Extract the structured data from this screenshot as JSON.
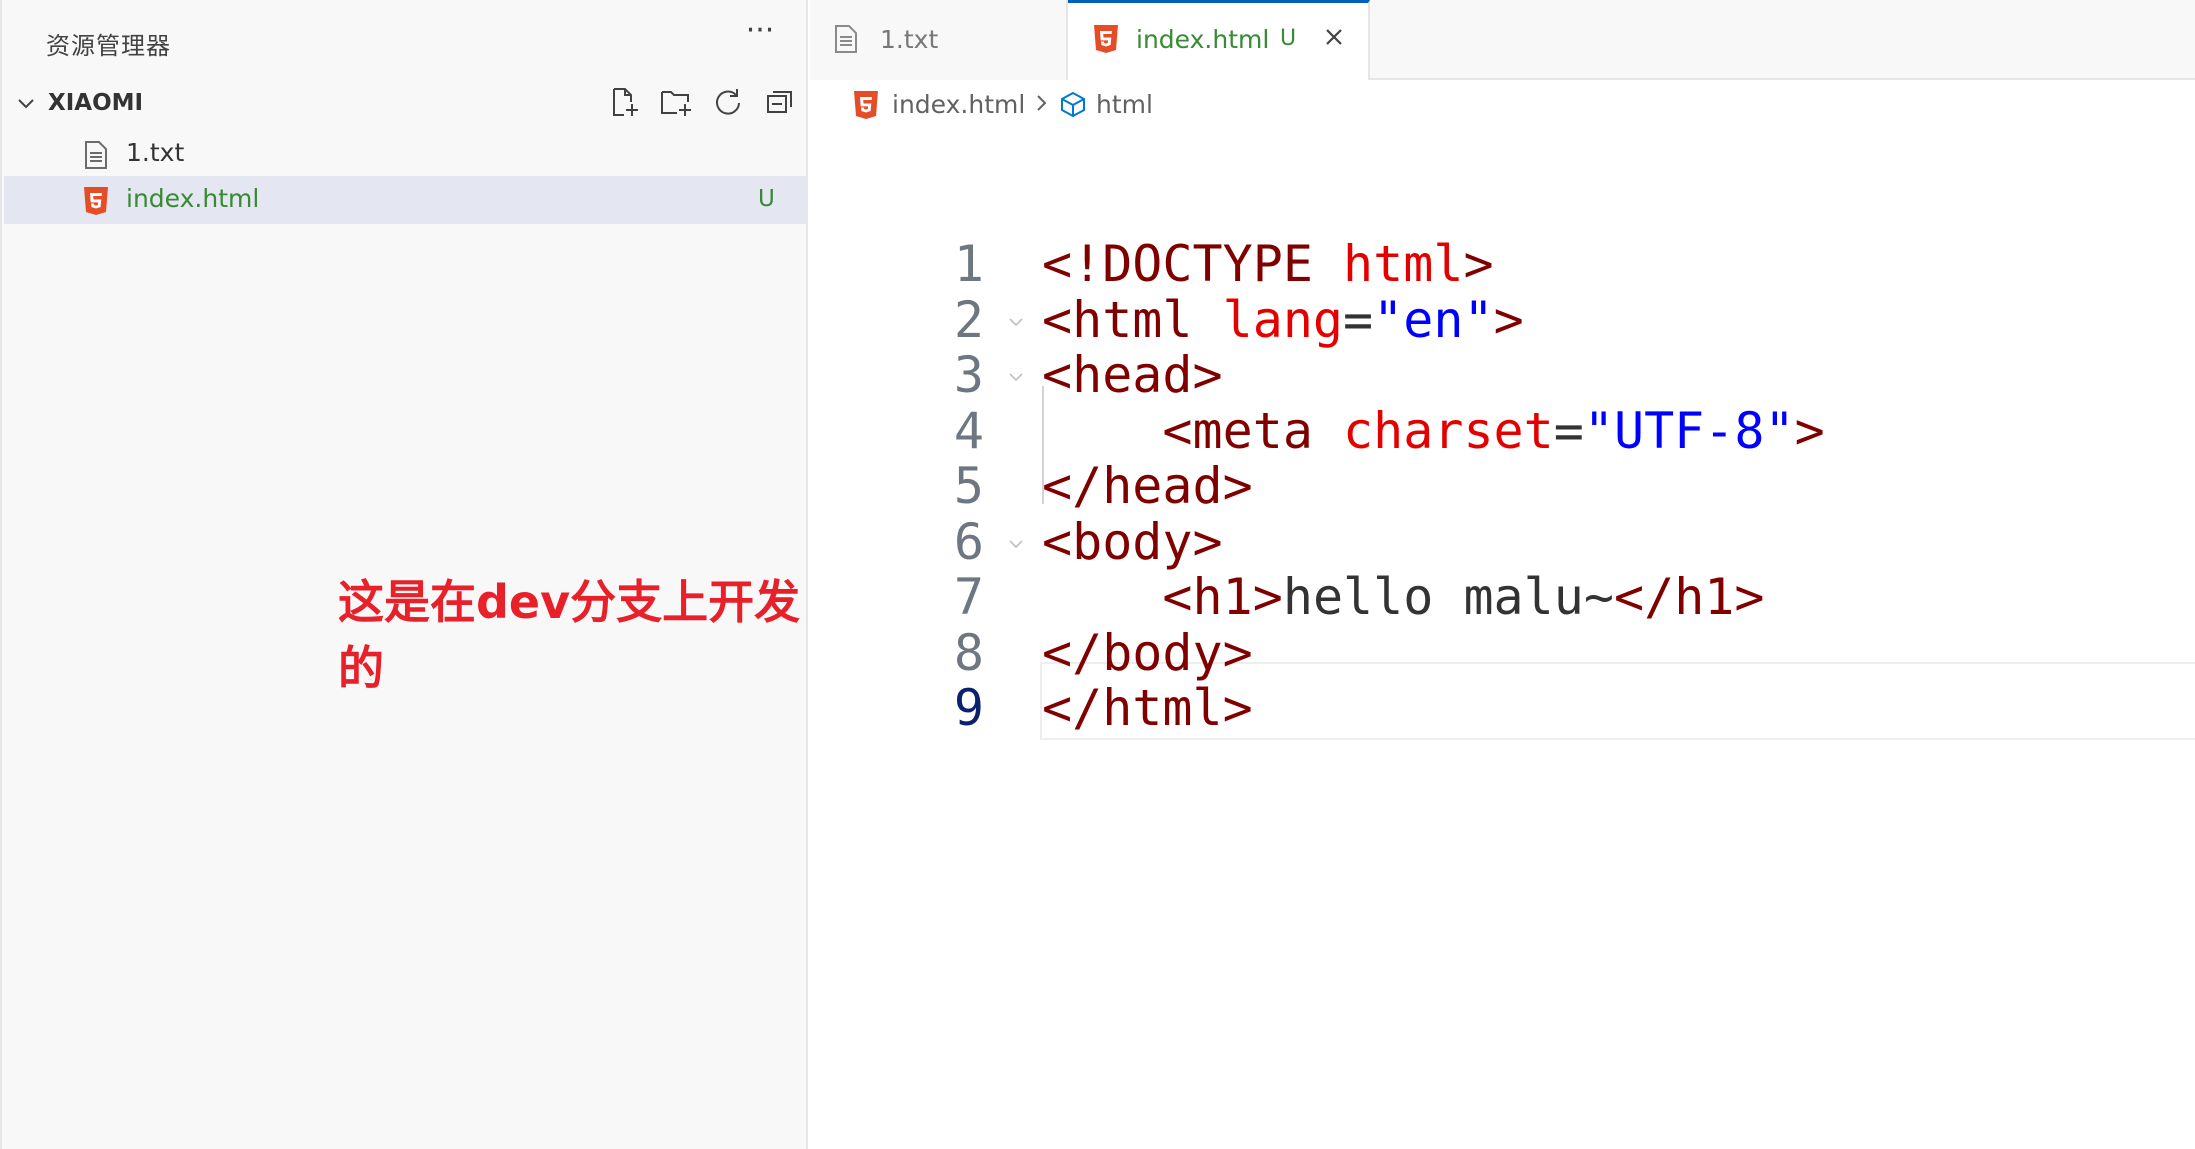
{
  "explorer": {
    "title": "资源管理器",
    "more_label": "···",
    "folder": {
      "name": "XIAOMI",
      "actions": [
        {
          "name": "new-file-icon"
        },
        {
          "name": "new-folder-icon"
        },
        {
          "name": "refresh-icon"
        },
        {
          "name": "collapse-all-icon"
        }
      ]
    },
    "files": [
      {
        "name": "1.txt",
        "icon": "text-file-icon",
        "badge": ""
      },
      {
        "name": "index.html",
        "icon": "html5-icon",
        "badge": "U"
      }
    ]
  },
  "annotation": "这是在dev分支上开发的",
  "tabs": [
    {
      "label": "1.txt",
      "icon": "text-file-icon"
    },
    {
      "label": "index.html",
      "icon": "html5-icon",
      "badge": "U",
      "close": "×"
    }
  ],
  "breadcrumb": {
    "file": "index.html",
    "symbol": "html"
  },
  "editor": {
    "line_numbers": [
      "1",
      "2",
      "3",
      "4",
      "5",
      "6",
      "7",
      "8",
      "9"
    ],
    "lines": {
      "l1": {
        "open": "<!DOCTYPE",
        "sp": " ",
        "name": "html",
        "close": ">"
      },
      "l2": {
        "open": "<html",
        "sp": " ",
        "attr": "lang",
        "eq": "=",
        "val": "\"en\"",
        "close": ">"
      },
      "l3": {
        "tag": "<head>"
      },
      "l4": {
        "indent": "    ",
        "open": "<meta",
        "sp": " ",
        "attr": "charset",
        "eq": "=",
        "val": "\"UTF-8\"",
        "close": ">"
      },
      "l5": {
        "tag": "</head>"
      },
      "l6": {
        "tag": "<body>"
      },
      "l7": {
        "indent": "    ",
        "open": "<h1>",
        "text": "hello malu~",
        "close": "</h1>"
      },
      "l8": {
        "tag": "</body>"
      },
      "l9": {
        "tag": "</html>"
      }
    }
  },
  "colors": {
    "accent": "#005fb8",
    "untracked": "#388a34",
    "selection": "#e4e6f1",
    "annotation": "#e8202a",
    "tag": "#800000",
    "attribute": "#e50000",
    "string": "#0000ff"
  }
}
